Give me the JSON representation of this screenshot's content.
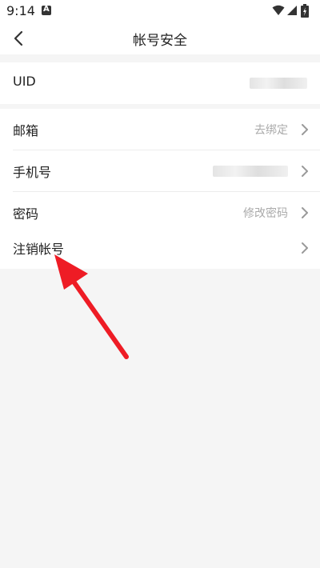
{
  "status_bar": {
    "time": "9:14",
    "notification_icon": "a-icon",
    "icons": [
      "wifi-icon",
      "signal-icon",
      "battery-icon"
    ]
  },
  "header": {
    "title": "帐号安全",
    "back_icon": "chevron-left-icon"
  },
  "sections": {
    "uid": {
      "label": "UID"
    },
    "contact": {
      "email": {
        "label": "邮箱",
        "value": "去绑定"
      },
      "phone": {
        "label": "手机号"
      },
      "password": {
        "label": "密码",
        "value": "修改密码"
      }
    },
    "account": {
      "delete": {
        "label": "注销帐号"
      }
    }
  },
  "colors": {
    "background": "#f5f5f5",
    "card": "#ffffff",
    "text": "#222222",
    "secondary_text": "#aaaaaa",
    "annotation_arrow": "#ee1c25"
  }
}
